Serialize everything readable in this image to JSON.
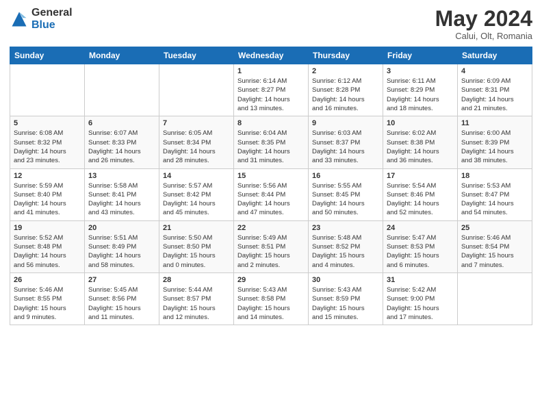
{
  "header": {
    "logo_general": "General",
    "logo_blue": "Blue",
    "month_title": "May 2024",
    "subtitle": "Calui, Olt, Romania"
  },
  "weekdays": [
    "Sunday",
    "Monday",
    "Tuesday",
    "Wednesday",
    "Thursday",
    "Friday",
    "Saturday"
  ],
  "weeks": [
    [
      {
        "day": "",
        "info": ""
      },
      {
        "day": "",
        "info": ""
      },
      {
        "day": "",
        "info": ""
      },
      {
        "day": "1",
        "info": "Sunrise: 6:14 AM\nSunset: 8:27 PM\nDaylight: 14 hours\nand 13 minutes."
      },
      {
        "day": "2",
        "info": "Sunrise: 6:12 AM\nSunset: 8:28 PM\nDaylight: 14 hours\nand 16 minutes."
      },
      {
        "day": "3",
        "info": "Sunrise: 6:11 AM\nSunset: 8:29 PM\nDaylight: 14 hours\nand 18 minutes."
      },
      {
        "day": "4",
        "info": "Sunrise: 6:09 AM\nSunset: 8:31 PM\nDaylight: 14 hours\nand 21 minutes."
      }
    ],
    [
      {
        "day": "5",
        "info": "Sunrise: 6:08 AM\nSunset: 8:32 PM\nDaylight: 14 hours\nand 23 minutes."
      },
      {
        "day": "6",
        "info": "Sunrise: 6:07 AM\nSunset: 8:33 PM\nDaylight: 14 hours\nand 26 minutes."
      },
      {
        "day": "7",
        "info": "Sunrise: 6:05 AM\nSunset: 8:34 PM\nDaylight: 14 hours\nand 28 minutes."
      },
      {
        "day": "8",
        "info": "Sunrise: 6:04 AM\nSunset: 8:35 PM\nDaylight: 14 hours\nand 31 minutes."
      },
      {
        "day": "9",
        "info": "Sunrise: 6:03 AM\nSunset: 8:37 PM\nDaylight: 14 hours\nand 33 minutes."
      },
      {
        "day": "10",
        "info": "Sunrise: 6:02 AM\nSunset: 8:38 PM\nDaylight: 14 hours\nand 36 minutes."
      },
      {
        "day": "11",
        "info": "Sunrise: 6:00 AM\nSunset: 8:39 PM\nDaylight: 14 hours\nand 38 minutes."
      }
    ],
    [
      {
        "day": "12",
        "info": "Sunrise: 5:59 AM\nSunset: 8:40 PM\nDaylight: 14 hours\nand 41 minutes."
      },
      {
        "day": "13",
        "info": "Sunrise: 5:58 AM\nSunset: 8:41 PM\nDaylight: 14 hours\nand 43 minutes."
      },
      {
        "day": "14",
        "info": "Sunrise: 5:57 AM\nSunset: 8:42 PM\nDaylight: 14 hours\nand 45 minutes."
      },
      {
        "day": "15",
        "info": "Sunrise: 5:56 AM\nSunset: 8:44 PM\nDaylight: 14 hours\nand 47 minutes."
      },
      {
        "day": "16",
        "info": "Sunrise: 5:55 AM\nSunset: 8:45 PM\nDaylight: 14 hours\nand 50 minutes."
      },
      {
        "day": "17",
        "info": "Sunrise: 5:54 AM\nSunset: 8:46 PM\nDaylight: 14 hours\nand 52 minutes."
      },
      {
        "day": "18",
        "info": "Sunrise: 5:53 AM\nSunset: 8:47 PM\nDaylight: 14 hours\nand 54 minutes."
      }
    ],
    [
      {
        "day": "19",
        "info": "Sunrise: 5:52 AM\nSunset: 8:48 PM\nDaylight: 14 hours\nand 56 minutes."
      },
      {
        "day": "20",
        "info": "Sunrise: 5:51 AM\nSunset: 8:49 PM\nDaylight: 14 hours\nand 58 minutes."
      },
      {
        "day": "21",
        "info": "Sunrise: 5:50 AM\nSunset: 8:50 PM\nDaylight: 15 hours\nand 0 minutes."
      },
      {
        "day": "22",
        "info": "Sunrise: 5:49 AM\nSunset: 8:51 PM\nDaylight: 15 hours\nand 2 minutes."
      },
      {
        "day": "23",
        "info": "Sunrise: 5:48 AM\nSunset: 8:52 PM\nDaylight: 15 hours\nand 4 minutes."
      },
      {
        "day": "24",
        "info": "Sunrise: 5:47 AM\nSunset: 8:53 PM\nDaylight: 15 hours\nand 6 minutes."
      },
      {
        "day": "25",
        "info": "Sunrise: 5:46 AM\nSunset: 8:54 PM\nDaylight: 15 hours\nand 7 minutes."
      }
    ],
    [
      {
        "day": "26",
        "info": "Sunrise: 5:46 AM\nSunset: 8:55 PM\nDaylight: 15 hours\nand 9 minutes."
      },
      {
        "day": "27",
        "info": "Sunrise: 5:45 AM\nSunset: 8:56 PM\nDaylight: 15 hours\nand 11 minutes."
      },
      {
        "day": "28",
        "info": "Sunrise: 5:44 AM\nSunset: 8:57 PM\nDaylight: 15 hours\nand 12 minutes."
      },
      {
        "day": "29",
        "info": "Sunrise: 5:43 AM\nSunset: 8:58 PM\nDaylight: 15 hours\nand 14 minutes."
      },
      {
        "day": "30",
        "info": "Sunrise: 5:43 AM\nSunset: 8:59 PM\nDaylight: 15 hours\nand 15 minutes."
      },
      {
        "day": "31",
        "info": "Sunrise: 5:42 AM\nSunset: 9:00 PM\nDaylight: 15 hours\nand 17 minutes."
      },
      {
        "day": "",
        "info": ""
      }
    ]
  ]
}
